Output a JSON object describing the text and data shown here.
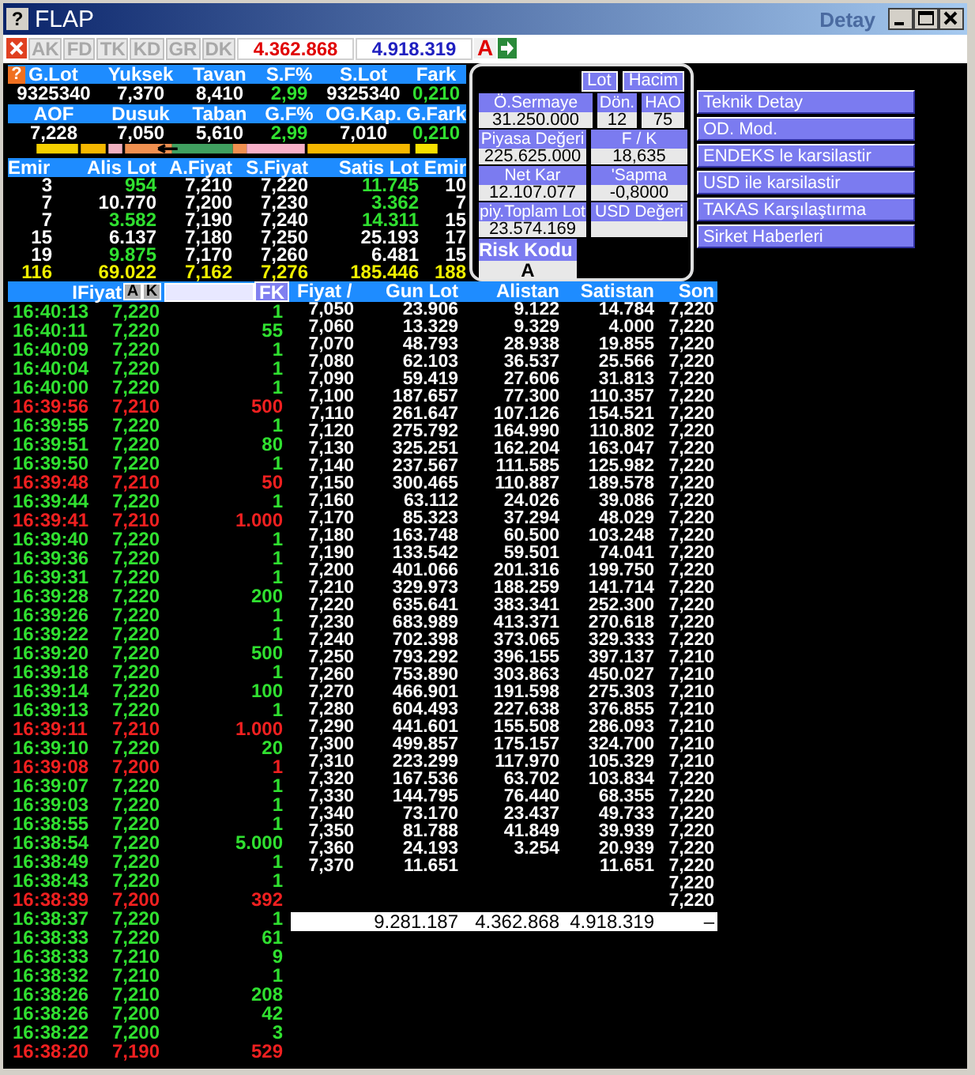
{
  "window": {
    "help_glyph": "?",
    "title": "FLAP",
    "subtitle": "Detay"
  },
  "toolbar": {
    "tabs": [
      {
        "label": "AK",
        "disabled": true
      },
      {
        "label": "FD",
        "disabled": true
      },
      {
        "label": "TK",
        "disabled": true
      },
      {
        "label": "KD",
        "disabled": true
      },
      {
        "label": "GR",
        "disabled": true
      },
      {
        "label": "DK",
        "disabled": true
      }
    ],
    "bid_total": "4.362.868",
    "ask_total": "4.918.319",
    "letter_button": "A"
  },
  "stats": {
    "help_glyph": "?",
    "rows": [
      {
        "headers": [
          "G.Lot",
          "Yuksek",
          "Tavan",
          "S.F%",
          "S.Lot",
          "Fark"
        ],
        "values": [
          {
            "text": "9325340",
            "up": false
          },
          {
            "text": "7,370",
            "up": false
          },
          {
            "text": "8,410",
            "up": false
          },
          {
            "text": "2,99",
            "up": true
          },
          {
            "text": "9325340",
            "up": false
          },
          {
            "text": "0,210",
            "up": true
          }
        ]
      },
      {
        "headers": [
          "AOF",
          "Dusuk",
          "Taban",
          "G.F%",
          "OG.Kap.",
          "G.Fark"
        ],
        "values": [
          {
            "text": "7,228",
            "up": false
          },
          {
            "text": "7,050",
            "up": false
          },
          {
            "text": "5,610",
            "up": false
          },
          {
            "text": "2,99",
            "up": true
          },
          {
            "text": "7,010",
            "up": false
          },
          {
            "text": "0,210",
            "up": true
          }
        ]
      }
    ]
  },
  "depth": {
    "columns": [
      "Emir",
      "Alis Lot",
      "A.Fiyat",
      "S.Fiyat",
      "Satis Lot",
      "Emir"
    ],
    "rows": [
      {
        "bid_orders": "3",
        "bid_lot": "954",
        "bid_price": "7,210",
        "ask_price": "7,220",
        "ask_lot": "11.745",
        "ask_orders": "10",
        "bid_lot_changed": true,
        "ask_lot_changed": true
      },
      {
        "bid_orders": "7",
        "bid_lot": "10.770",
        "bid_price": "7,200",
        "ask_price": "7,230",
        "ask_lot": "3.362",
        "ask_orders": "7",
        "bid_lot_changed": false,
        "ask_lot_changed": true
      },
      {
        "bid_orders": "7",
        "bid_lot": "3.582",
        "bid_price": "7,190",
        "ask_price": "7,240",
        "ask_lot": "14.311",
        "ask_orders": "15",
        "bid_lot_changed": true,
        "ask_lot_changed": true
      },
      {
        "bid_orders": "15",
        "bid_lot": "6.137",
        "bid_price": "7,180",
        "ask_price": "7,250",
        "ask_lot": "25.193",
        "ask_orders": "17",
        "bid_lot_changed": false,
        "ask_lot_changed": false
      },
      {
        "bid_orders": "19",
        "bid_lot": "9.875",
        "bid_price": "7,170",
        "ask_price": "7,260",
        "ask_lot": "6.481",
        "ask_orders": "15",
        "bid_lot_changed": true,
        "ask_lot_changed": false
      }
    ],
    "total": {
      "bid_orders": "116",
      "bid_lot": "69.022",
      "bid_price": "7,162",
      "ask_price": "7,276",
      "ask_lot": "185.446",
      "ask_orders": "188"
    }
  },
  "info_panel": {
    "buttons": [
      "Lot",
      "Hacim"
    ],
    "rows": [
      {
        "fields": [
          {
            "label": "Ö.Sermaye",
            "value": "31.250.000"
          },
          {
            "label": "Dön.",
            "value": "12"
          },
          {
            "label": "HAO",
            "value": "75"
          }
        ]
      },
      {
        "fields": [
          {
            "label": "Piyasa Değeri",
            "value": "225.625.000"
          },
          {
            "label": "F / K",
            "value": "18,635"
          }
        ]
      },
      {
        "fields": [
          {
            "label": "Net Kar",
            "value": "12.107.077"
          },
          {
            "label": "'Sapma",
            "value": "-0,8000"
          }
        ]
      },
      {
        "fields": [
          {
            "label": "piy.Toplam Lot",
            "value": "23.574.169"
          },
          {
            "label": "USD Değeri"
          }
        ]
      }
    ],
    "risk": {
      "label": "Risk Kodu",
      "value": "A"
    }
  },
  "actions": [
    "Teknik Detay",
    "OD. Mod.",
    "ENDEKS le karsilastir",
    "USD ile karsilastir",
    "TAKAS Karşılaştırma",
    "Sirket Haberleri"
  ],
  "trades": {
    "header": {
      "label": "IFiyat",
      "buttons": [
        "A",
        "K"
      ],
      "filter_button": "FK"
    },
    "rows": [
      {
        "time": "16:40:13",
        "price": "7,220",
        "lot": "1",
        "falling": false
      },
      {
        "time": "16:40:11",
        "price": "7,220",
        "lot": "55",
        "falling": false
      },
      {
        "time": "16:40:09",
        "price": "7,220",
        "lot": "1",
        "falling": false
      },
      {
        "time": "16:40:04",
        "price": "7,220",
        "lot": "1",
        "falling": false
      },
      {
        "time": "16:40:00",
        "price": "7,220",
        "lot": "1",
        "falling": false
      },
      {
        "time": "16:39:56",
        "price": "7,210",
        "lot": "500",
        "falling": true
      },
      {
        "time": "16:39:55",
        "price": "7,220",
        "lot": "1",
        "falling": false
      },
      {
        "time": "16:39:51",
        "price": "7,220",
        "lot": "80",
        "falling": false
      },
      {
        "time": "16:39:50",
        "price": "7,220",
        "lot": "1",
        "falling": false
      },
      {
        "time": "16:39:48",
        "price": "7,210",
        "lot": "50",
        "falling": true
      },
      {
        "time": "16:39:44",
        "price": "7,220",
        "lot": "1",
        "falling": false
      },
      {
        "time": "16:39:41",
        "price": "7,210",
        "lot": "1.000",
        "falling": true
      },
      {
        "time": "16:39:40",
        "price": "7,220",
        "lot": "1",
        "falling": false
      },
      {
        "time": "16:39:36",
        "price": "7,220",
        "lot": "1",
        "falling": false
      },
      {
        "time": "16:39:31",
        "price": "7,220",
        "lot": "1",
        "falling": false
      },
      {
        "time": "16:39:28",
        "price": "7,220",
        "lot": "200",
        "falling": false
      },
      {
        "time": "16:39:26",
        "price": "7,220",
        "lot": "1",
        "falling": false
      },
      {
        "time": "16:39:22",
        "price": "7,220",
        "lot": "1",
        "falling": false
      },
      {
        "time": "16:39:20",
        "price": "7,220",
        "lot": "500",
        "falling": false
      },
      {
        "time": "16:39:18",
        "price": "7,220",
        "lot": "1",
        "falling": false
      },
      {
        "time": "16:39:14",
        "price": "7,220",
        "lot": "100",
        "falling": false
      },
      {
        "time": "16:39:13",
        "price": "7,220",
        "lot": "1",
        "falling": false
      },
      {
        "time": "16:39:11",
        "price": "7,210",
        "lot": "1.000",
        "falling": true
      },
      {
        "time": "16:39:10",
        "price": "7,220",
        "lot": "20",
        "falling": false
      },
      {
        "time": "16:39:08",
        "price": "7,200",
        "lot": "1",
        "falling": true
      },
      {
        "time": "16:39:07",
        "price": "7,220",
        "lot": "1",
        "falling": false
      },
      {
        "time": "16:39:03",
        "price": "7,220",
        "lot": "1",
        "falling": false
      },
      {
        "time": "16:38:55",
        "price": "7,220",
        "lot": "1",
        "falling": false
      },
      {
        "time": "16:38:54",
        "price": "7,220",
        "lot": "5.000",
        "falling": false
      },
      {
        "time": "16:38:49",
        "price": "7,220",
        "lot": "1",
        "falling": false
      },
      {
        "time": "16:38:43",
        "price": "7,220",
        "lot": "1",
        "falling": false
      },
      {
        "time": "16:38:39",
        "price": "7,200",
        "lot": "392",
        "falling": true
      },
      {
        "time": "16:38:37",
        "price": "7,220",
        "lot": "1",
        "falling": false
      },
      {
        "time": "16:38:33",
        "price": "7,220",
        "lot": "61",
        "falling": false
      },
      {
        "time": "16:38:33",
        "price": "7,210",
        "lot": "9",
        "falling": false
      },
      {
        "time": "16:38:32",
        "price": "7,210",
        "lot": "1",
        "falling": false
      },
      {
        "time": "16:38:26",
        "price": "7,210",
        "lot": "208",
        "falling": false
      },
      {
        "time": "16:38:26",
        "price": "7,200",
        "lot": "42",
        "falling": false
      },
      {
        "time": "16:38:22",
        "price": "7,200",
        "lot": "3",
        "falling": false
      },
      {
        "time": "16:38:20",
        "price": "7,190",
        "lot": "529",
        "falling": true
      }
    ]
  },
  "price_table": {
    "columns": [
      "Fiyat /",
      "Gun Lot",
      "Alistan",
      "Satistan",
      "Son"
    ],
    "rows": [
      {
        "price": "7,050",
        "gun_lot": "23.906",
        "alistan": "9.122",
        "satistan": "14.784",
        "son": "7,220"
      },
      {
        "price": "7,060",
        "gun_lot": "13.329",
        "alistan": "9.329",
        "satistan": "4.000",
        "son": "7,220"
      },
      {
        "price": "7,070",
        "gun_lot": "48.793",
        "alistan": "28.938",
        "satistan": "19.855",
        "son": "7,220"
      },
      {
        "price": "7,080",
        "gun_lot": "62.103",
        "alistan": "36.537",
        "satistan": "25.566",
        "son": "7,220"
      },
      {
        "price": "7,090",
        "gun_lot": "59.419",
        "alistan": "27.606",
        "satistan": "31.813",
        "son": "7,220"
      },
      {
        "price": "7,100",
        "gun_lot": "187.657",
        "alistan": "77.300",
        "satistan": "110.357",
        "son": "7,220"
      },
      {
        "price": "7,110",
        "gun_lot": "261.647",
        "alistan": "107.126",
        "satistan": "154.521",
        "son": "7,220"
      },
      {
        "price": "7,120",
        "gun_lot": "275.792",
        "alistan": "164.990",
        "satistan": "110.802",
        "son": "7,220"
      },
      {
        "price": "7,130",
        "gun_lot": "325.251",
        "alistan": "162.204",
        "satistan": "163.047",
        "son": "7,220"
      },
      {
        "price": "7,140",
        "gun_lot": "237.567",
        "alistan": "111.585",
        "satistan": "125.982",
        "son": "7,220"
      },
      {
        "price": "7,150",
        "gun_lot": "300.465",
        "alistan": "110.887",
        "satistan": "189.578",
        "son": "7,220"
      },
      {
        "price": "7,160",
        "gun_lot": "63.112",
        "alistan": "24.026",
        "satistan": "39.086",
        "son": "7,220"
      },
      {
        "price": "7,170",
        "gun_lot": "85.323",
        "alistan": "37.294",
        "satistan": "48.029",
        "son": "7,220"
      },
      {
        "price": "7,180",
        "gun_lot": "163.748",
        "alistan": "60.500",
        "satistan": "103.248",
        "son": "7,220"
      },
      {
        "price": "7,190",
        "gun_lot": "133.542",
        "alistan": "59.501",
        "satistan": "74.041",
        "son": "7,220"
      },
      {
        "price": "7,200",
        "gun_lot": "401.066",
        "alistan": "201.316",
        "satistan": "199.750",
        "son": "7,220"
      },
      {
        "price": "7,210",
        "gun_lot": "329.973",
        "alistan": "188.259",
        "satistan": "141.714",
        "son": "7,220"
      },
      {
        "price": "7,220",
        "gun_lot": "635.641",
        "alistan": "383.341",
        "satistan": "252.300",
        "son": "7,220"
      },
      {
        "price": "7,230",
        "gun_lot": "683.989",
        "alistan": "413.371",
        "satistan": "270.618",
        "son": "7,220"
      },
      {
        "price": "7,240",
        "gun_lot": "702.398",
        "alistan": "373.065",
        "satistan": "329.333",
        "son": "7,220"
      },
      {
        "price": "7,250",
        "gun_lot": "793.292",
        "alistan": "396.155",
        "satistan": "397.137",
        "son": "7,210"
      },
      {
        "price": "7,260",
        "gun_lot": "753.890",
        "alistan": "303.863",
        "satistan": "450.027",
        "son": "7,210"
      },
      {
        "price": "7,270",
        "gun_lot": "466.901",
        "alistan": "191.598",
        "satistan": "275.303",
        "son": "7,210"
      },
      {
        "price": "7,280",
        "gun_lot": "604.493",
        "alistan": "227.638",
        "satistan": "376.855",
        "son": "7,210"
      },
      {
        "price": "7,290",
        "gun_lot": "441.601",
        "alistan": "155.508",
        "satistan": "286.093",
        "son": "7,210"
      },
      {
        "price": "7,300",
        "gun_lot": "499.857",
        "alistan": "175.157",
        "satistan": "324.700",
        "son": "7,210"
      },
      {
        "price": "7,310",
        "gun_lot": "223.299",
        "alistan": "117.970",
        "satistan": "105.329",
        "son": "7,210"
      },
      {
        "price": "7,320",
        "gun_lot": "167.536",
        "alistan": "63.702",
        "satistan": "103.834",
        "son": "7,220"
      },
      {
        "price": "7,330",
        "gun_lot": "144.795",
        "alistan": "76.440",
        "satistan": "68.355",
        "son": "7,220"
      },
      {
        "price": "7,340",
        "gun_lot": "73.170",
        "alistan": "23.437",
        "satistan": "49.733",
        "son": "7,220"
      },
      {
        "price": "7,350",
        "gun_lot": "81.788",
        "alistan": "41.849",
        "satistan": "39.939",
        "son": "7,220"
      },
      {
        "price": "7,360",
        "gun_lot": "24.193",
        "alistan": "3.254",
        "satistan": "20.939",
        "son": "7,220"
      },
      {
        "price": "7,370",
        "gun_lot": "11.651",
        "satistan": "11.651",
        "son": "7,220"
      },
      {
        "son": "7,220"
      },
      {
        "son": "7,220"
      }
    ],
    "total": {
      "gun_lot": "9.281.187",
      "alistan": "4.362.868",
      "satistan": "4.918.319",
      "son": "–"
    }
  }
}
